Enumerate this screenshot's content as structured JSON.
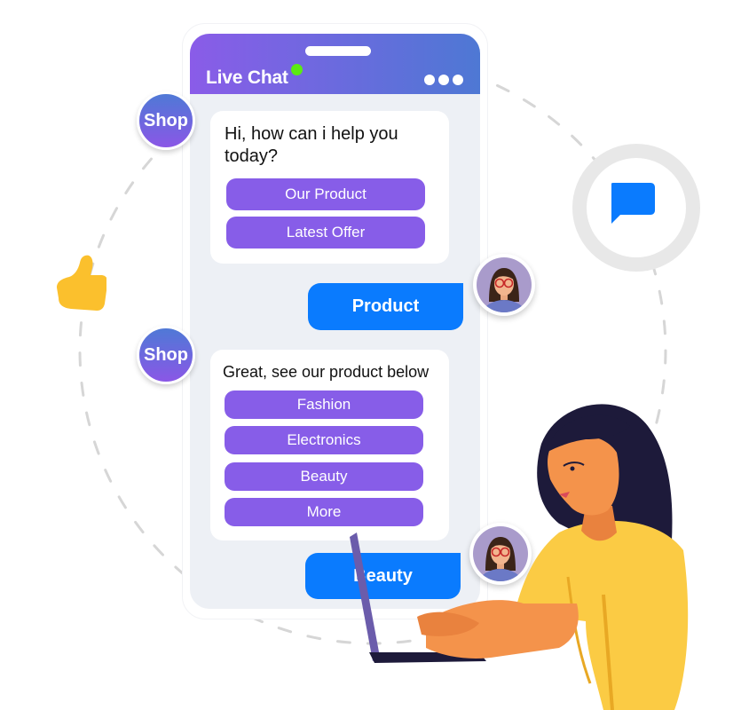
{
  "header": {
    "title": "Live Chat",
    "status": "online",
    "menu_icon": "more-dots-icon"
  },
  "colors": {
    "header_gradient_start": "#8a5ce8",
    "header_gradient_end": "#4e78d4",
    "option_button": "#875de8",
    "reply_bubble": "#0a7bfe",
    "online_dot": "#5aeb12",
    "chat_background": "#edf0f5",
    "thumb": "#fbc02d"
  },
  "messages": [
    {
      "sender": "Shop",
      "text": "Hi, how can i help you today?",
      "options": [
        "Our Product",
        "Latest Offer"
      ]
    },
    {
      "sender": "user",
      "text": "Product"
    },
    {
      "sender": "Shop",
      "text": "Great, see our product below",
      "options": [
        "Fashion",
        "Electronics",
        "Beauty",
        "More"
      ]
    },
    {
      "sender": "user",
      "text": "Beauty"
    }
  ],
  "decorations": {
    "left_icon": "thumbs-up-icon",
    "right_icon": "chat-bubble-icon",
    "illustration": "woman-typing-on-laptop"
  }
}
